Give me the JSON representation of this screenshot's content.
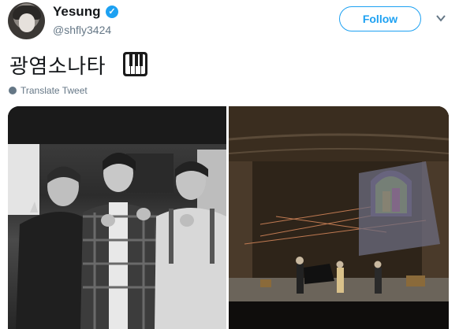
{
  "header": {
    "display_name": "Yesung",
    "handle": "@shfly3424",
    "follow_label": "Follow"
  },
  "tweet": {
    "text": "광염소나타",
    "emoji": "piano-icon",
    "translate_label": "Translate Tweet"
  },
  "colors": {
    "accent": "#1da1f2",
    "secondary_text": "#657786",
    "primary_text": "#14171a"
  },
  "media": {
    "count": 2
  }
}
